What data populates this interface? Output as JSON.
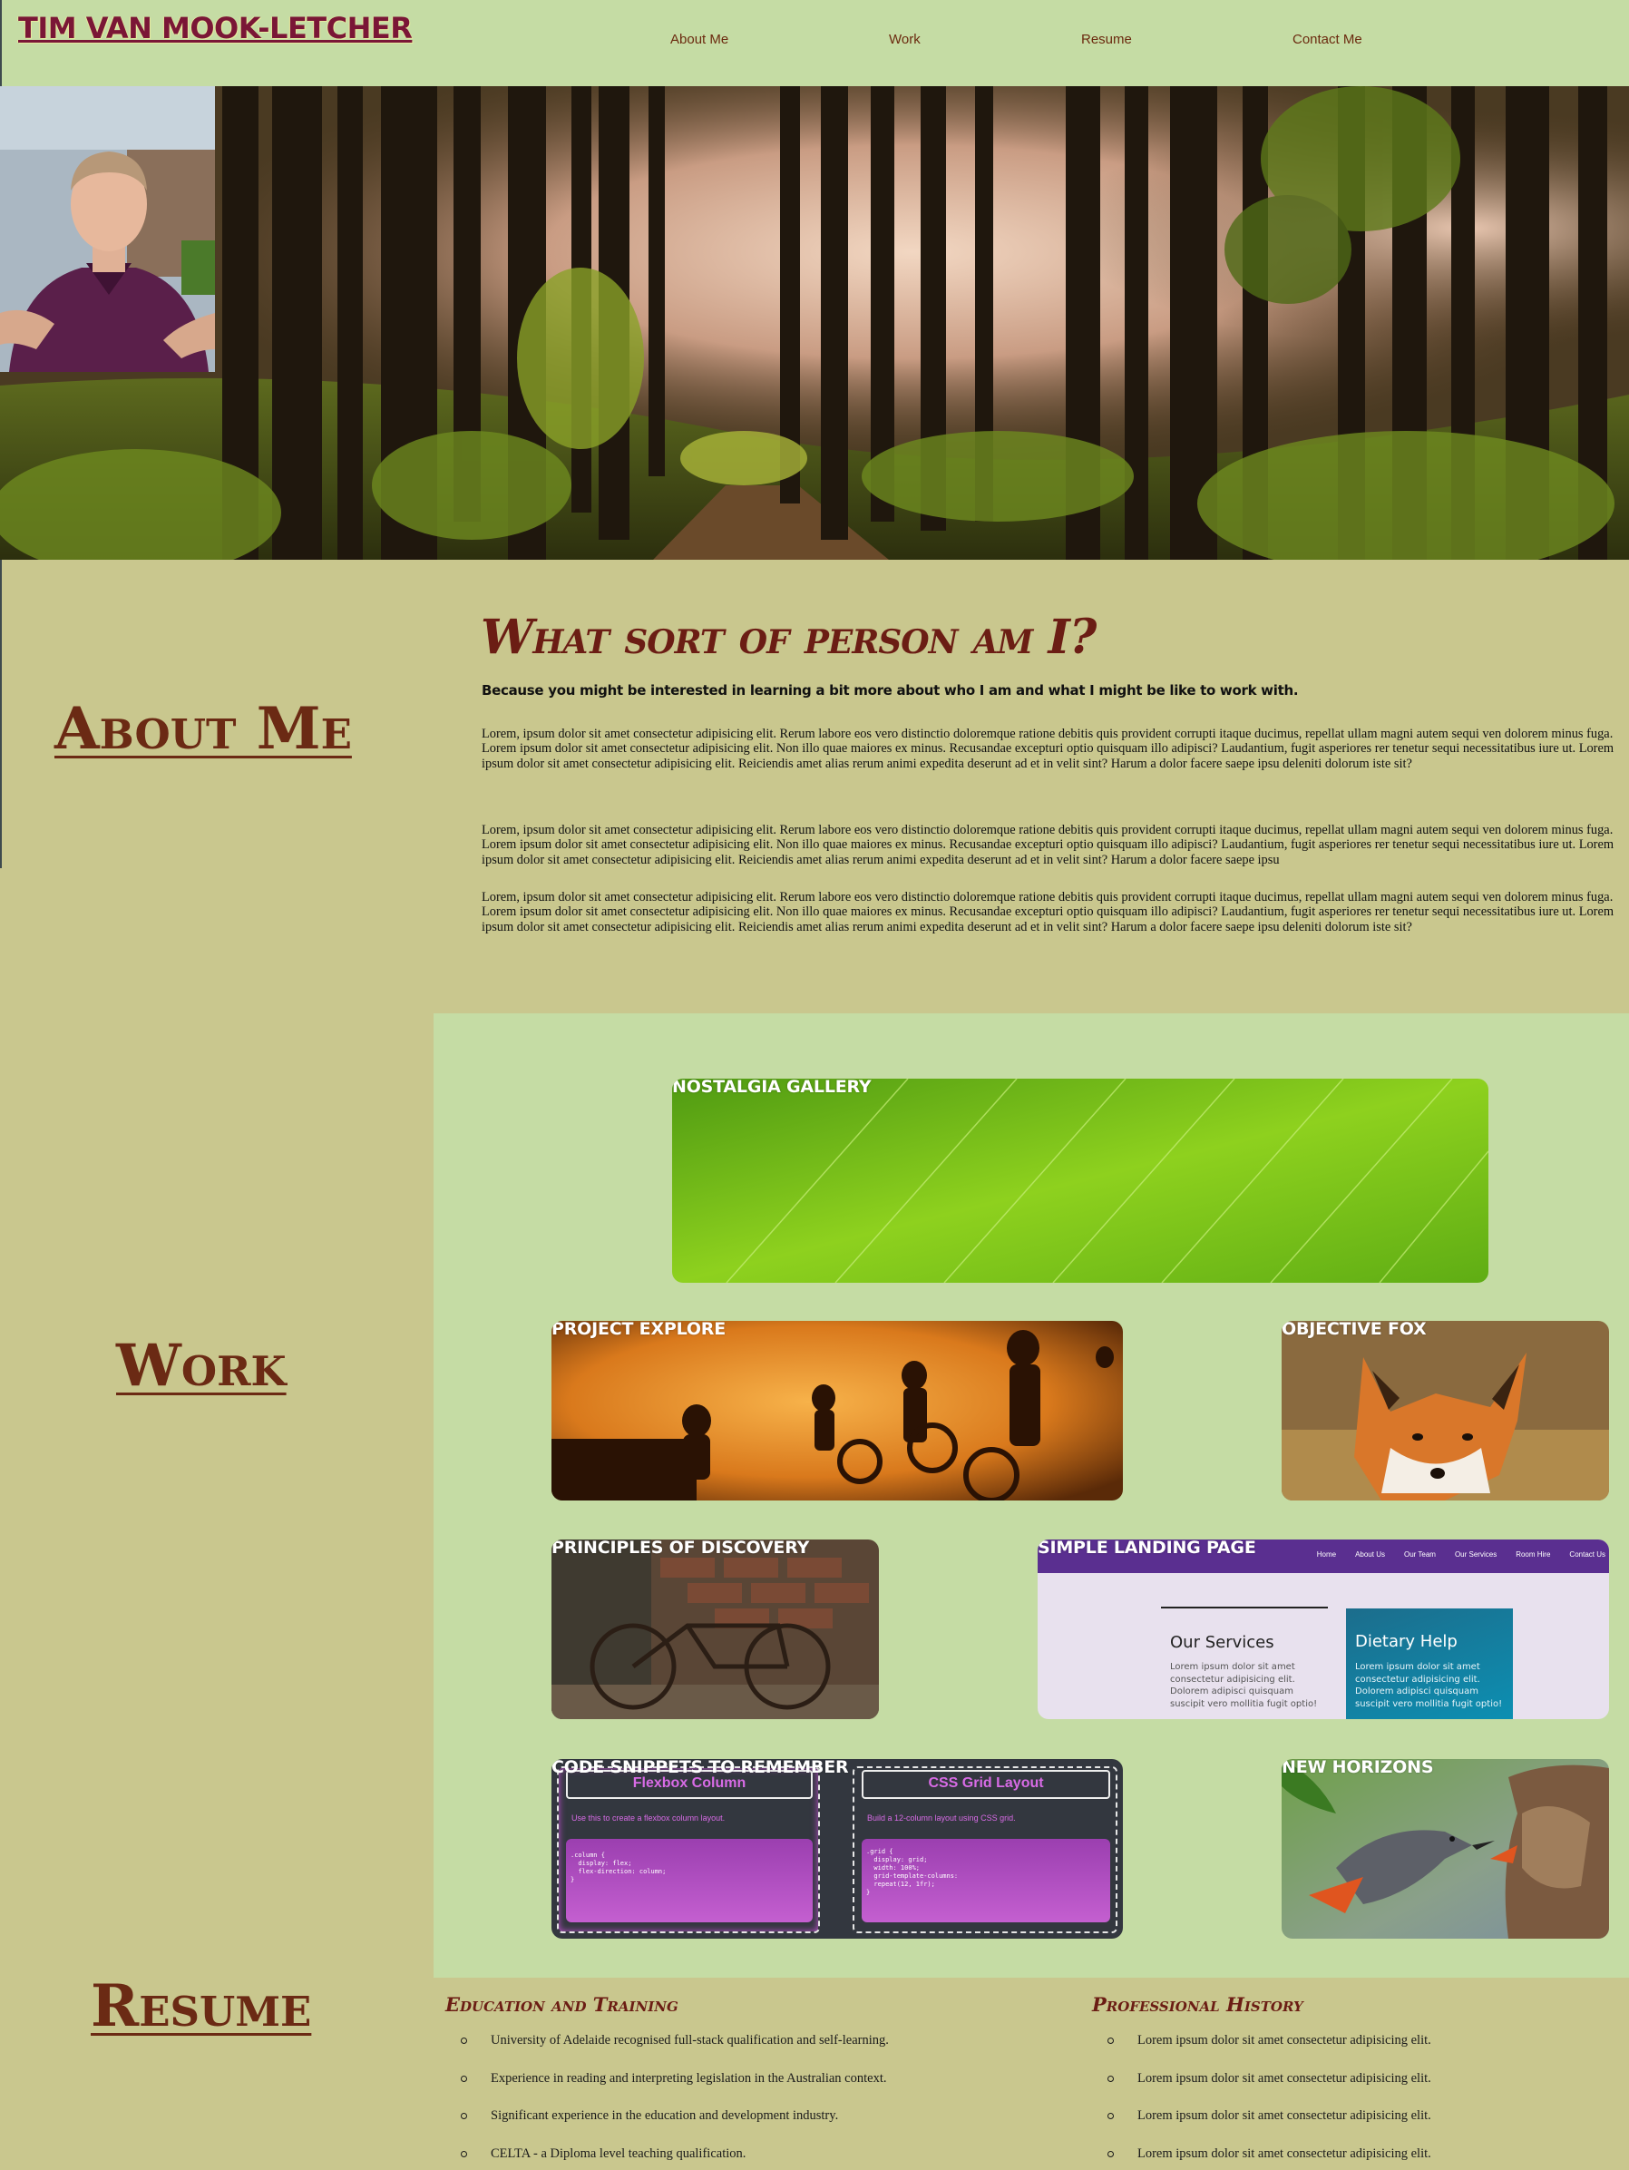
{
  "header": {
    "site_title": "TIM VAN MOOK-LETCHER",
    "nav": [
      "About Me",
      "Work",
      "Resume",
      "Contact Me"
    ]
  },
  "hero": {
    "image": "forest-path-photo",
    "portrait": "profile-photo"
  },
  "about": {
    "section_label": "About Me",
    "title": "What sort of person am I?",
    "subtitle": "Because you might be interested in learning a bit more about who I am and what I might be like to work with.",
    "paragraphs": [
      "Lorem, ipsum dolor sit amet consectetur adipisicing elit. Rerum labore eos vero distinctio doloremque ratione debitis quis provident corrupti itaque ducimus, repellat ullam magni autem sequi ven dolorem minus fuga. Lorem ipsum dolor sit amet consectetur adipisicing elit. Non illo quae maiores ex minus. Recusandae excepturi optio quisquam illo adipisci? Laudantium, fugit asperiores rer tenetur sequi necessitatibus iure ut. Lorem ipsum dolor sit amet consectetur adipisicing elit. Reiciendis amet alias rerum animi expedita deserunt ad et in velit sint? Harum a dolor facere saepe ipsu deleniti dolorum iste sit?",
      "Lorem, ipsum dolor sit amet consectetur adipisicing elit. Rerum labore eos vero distinctio doloremque ratione debitis quis provident corrupti itaque ducimus, repellat ullam magni autem sequi ven dolorem minus fuga. Lorem ipsum dolor sit amet consectetur adipisicing elit. Non illo quae maiores ex minus. Recusandae excepturi optio quisquam illo adipisci? Laudantium, fugit asperiores rer tenetur sequi necessitatibus iure ut. Lorem ipsum dolor sit amet consectetur adipisicing elit. Reiciendis amet alias rerum animi expedita deserunt ad et in velit sint? Harum a dolor facere saepe ipsu",
      "Lorem, ipsum dolor sit amet consectetur adipisicing elit. Rerum labore eos vero distinctio doloremque ratione debitis quis provident corrupti itaque ducimus, repellat ullam magni autem sequi ven dolorem minus fuga. Lorem ipsum dolor sit amet consectetur adipisicing elit. Non illo quae maiores ex minus. Recusandae excepturi optio quisquam illo adipisci? Laudantium, fugit asperiores rer tenetur sequi necessitatibus iure ut. Lorem ipsum dolor sit amet consectetur adipisicing elit. Reiciendis amet alias rerum animi expedita deserunt ad et in velit sint? Harum a dolor facere saepe ipsu deleniti dolorum iste sit?"
    ]
  },
  "work": {
    "section_label": "Work",
    "projects": [
      {
        "title": "NOSTALGIA GALLERY",
        "image": "green-leaf-photo"
      },
      {
        "title": "PROJECT EXPLORE",
        "image": "children-running-photo"
      },
      {
        "title": "OBJECTIVE FOX",
        "image": "fox-photo"
      },
      {
        "title": "PRINCIPLES OF DISCOVERY",
        "image": "old-bicycle-photo"
      },
      {
        "title": "SIMPLE LANDING PAGE",
        "image": "landing-page-screenshot"
      },
      {
        "title": "CODE SNIPPETS TO REMEMBER",
        "image": "code-snippets-screenshot"
      },
      {
        "title": "NEW HORIZONS",
        "image": "birds-feeding-photo"
      }
    ],
    "landing_preview": {
      "nav": [
        "Home",
        "About Us",
        "Our Team",
        "Our Services",
        "Room Hire",
        "Contact Us"
      ],
      "services_title": "Our Services",
      "services_text": "Lorem ipsum dolor sit amet consectetur adipisicing elit. Dolorem adipisci quisquam suscipit vero mollitia fugit optio!",
      "dietary_title": "Dietary Help",
      "dietary_text": "Lorem ipsum dolor sit amet consectetur adipisicing elit. Dolorem adipisci quisquam suscipit vero mollitia fugit optio!"
    },
    "snippets_preview": {
      "flex_title": "Flexbox Column",
      "flex_desc": "Use this to create a flexbox column layout.",
      "flex_code": ".column {\n  display: flex;\n  flex-direction: column;\n}",
      "grid_title": "CSS Grid Layout",
      "grid_desc": "Build a 12-column layout using CSS grid.",
      "grid_code": ".grid {\n  display: grid;\n  width: 100%;\n  grid-template-columns:\n  repeat(12, 1fr);\n}"
    }
  },
  "resume": {
    "section_label": "Resume",
    "education": {
      "heading": "Education and Training",
      "items": [
        "University of Adelaide recognised full-stack qualification and self-learning.",
        "Experience in reading and interpreting legislation in the Australian context.",
        "Significant experience in the education and development industry.",
        "CELTA - a Diploma level teaching qualification."
      ]
    },
    "professional": {
      "heading": "Professional History",
      "items": [
        "Lorem ipsum dolor sit amet consectetur adipisicing elit.",
        "Lorem ipsum dolor sit amet consectetur adipisicing elit.",
        "Lorem ipsum dolor sit amet consectetur adipisicing elit.",
        "Lorem ipsum dolor sit amet consectetur adipisicing elit."
      ]
    }
  },
  "colors": {
    "header_bg": "#c5dca4",
    "page_bg": "#c9c78e",
    "accent_maroon": "#6b1d14",
    "title_maroon": "#7a1636"
  }
}
